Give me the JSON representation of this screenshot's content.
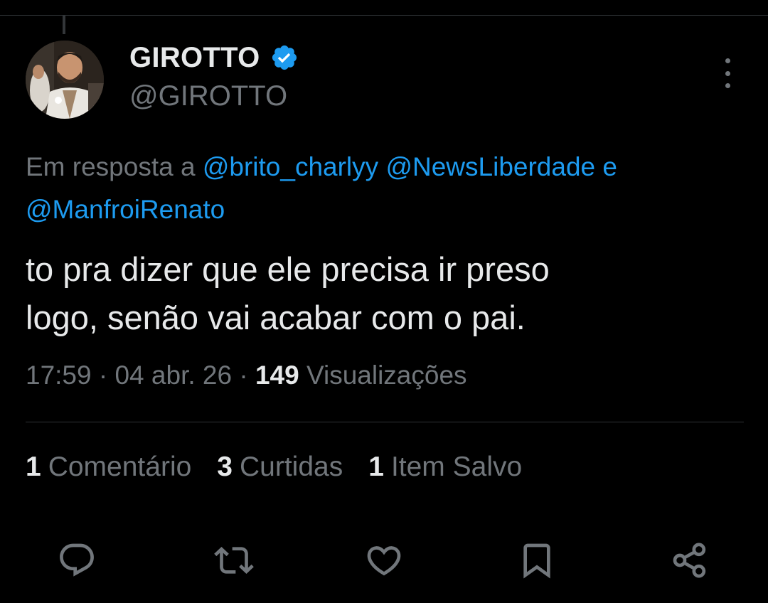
{
  "tweet": {
    "author": {
      "display_name": "GIROTTO",
      "handle": "@GIROTTO",
      "verified": true
    },
    "reply_to": {
      "prefix": "Em resposta a",
      "mentions": [
        "@brito_charlyy",
        "@NewsLiberdade",
        "@ManfroiRenato"
      ],
      "conjunction": "e"
    },
    "text_line1": "to pra dizer que ele precisa ir preso",
    "text_line2": "logo, senão vai acabar com o pai.",
    "meta": {
      "time": "17:59",
      "separator": "·",
      "date": "04 abr. 26",
      "views_count": "149",
      "views_label": "Visualizações"
    },
    "stats": [
      {
        "count": "1",
        "label": "Comentário"
      },
      {
        "count": "3",
        "label": "Curtidas"
      },
      {
        "count": "1",
        "label": "Item Salvo"
      }
    ]
  },
  "icons": {
    "verified": "verified-badge-icon",
    "more": "more-options-icon",
    "reply": "reply-icon",
    "retweet": "retweet-icon",
    "like": "like-icon",
    "bookmark": "bookmark-icon",
    "share": "share-icon"
  },
  "colors": {
    "background": "#000000",
    "text_primary": "#e7e9ea",
    "text_secondary": "#71767b",
    "accent": "#1d9bf0",
    "divider": "#2f3336"
  }
}
